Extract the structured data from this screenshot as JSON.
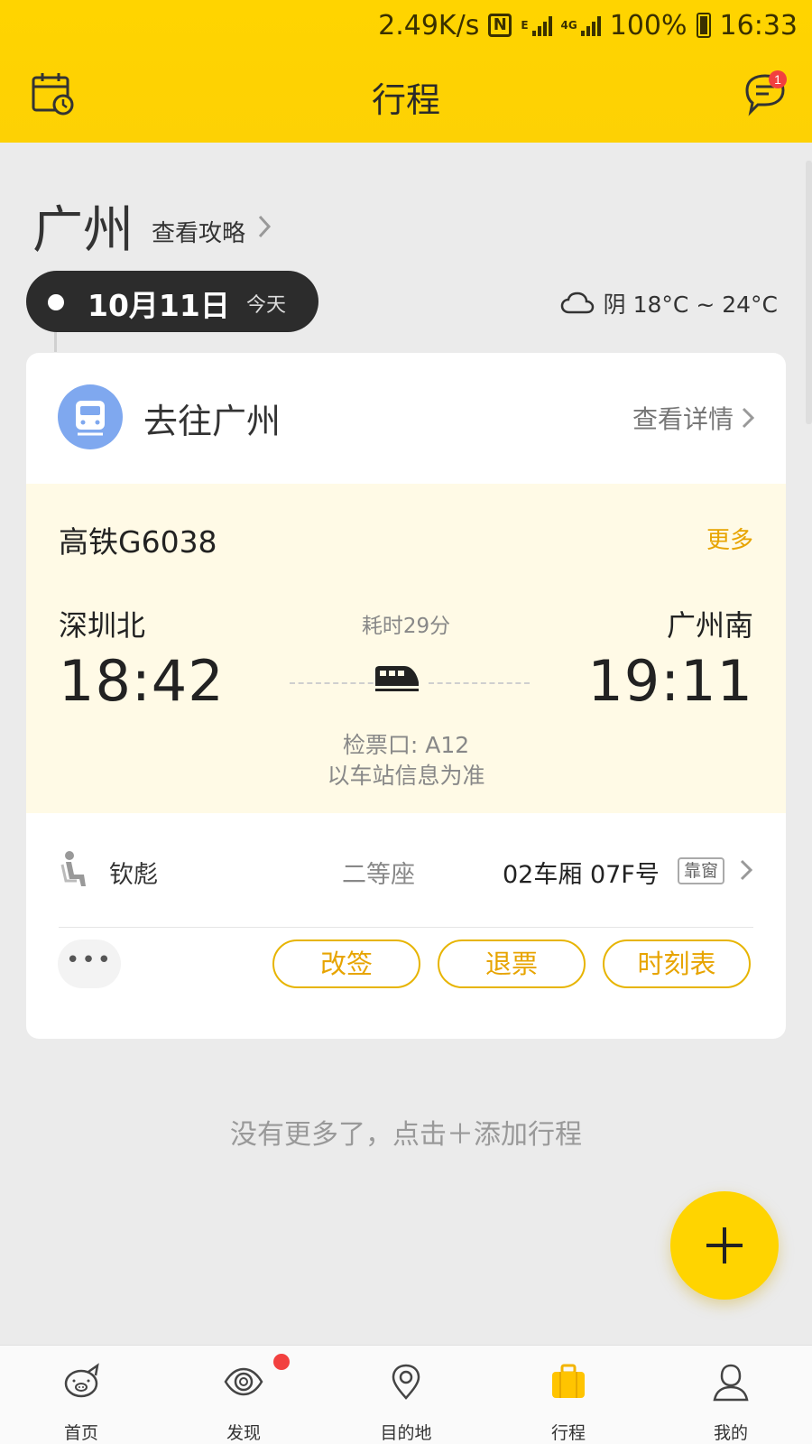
{
  "status_bar": {
    "speed": "2.49K/s",
    "nfc": "N",
    "e_tag": "E",
    "g4_tag": "4G",
    "battery": "100%",
    "time": "16:33"
  },
  "header": {
    "title": "行程",
    "message_badge": "1",
    "accent_color": "#ffd400"
  },
  "destination": {
    "city": "广州",
    "guide_link": "查看攻略"
  },
  "date_bar": {
    "date": "10月11日",
    "day_label": "今天",
    "weather": "阴 18°C ~ 24°C"
  },
  "trip_card": {
    "title": "去往广州",
    "detail_link": "查看详情",
    "train": {
      "number": "高铁G6038",
      "more": "更多",
      "from_station": "深圳北",
      "to_station": "广州南",
      "depart_time": "18:42",
      "arrive_time": "19:11",
      "duration": "耗时29分",
      "gate": "检票口: A12",
      "gate_note": "以车站信息为准"
    },
    "passenger": {
      "name": "钦彪",
      "seat_class": "二等座",
      "seat": "02车厢 07F号",
      "seat_tag": "靠窗"
    },
    "actions": {
      "more_dots": "•••",
      "change": "改签",
      "refund": "退票",
      "timetable": "时刻表"
    }
  },
  "footer_note": "没有更多了，点击＋添加行程",
  "bottom_nav": [
    {
      "label": "首页",
      "icon": "pig-home-icon"
    },
    {
      "label": "发现",
      "icon": "eye-discover-icon"
    },
    {
      "label": "目的地",
      "icon": "location-pin-icon"
    },
    {
      "label": "行程",
      "icon": "suitcase-icon",
      "active": true
    },
    {
      "label": "我的",
      "icon": "user-profile-icon"
    }
  ]
}
